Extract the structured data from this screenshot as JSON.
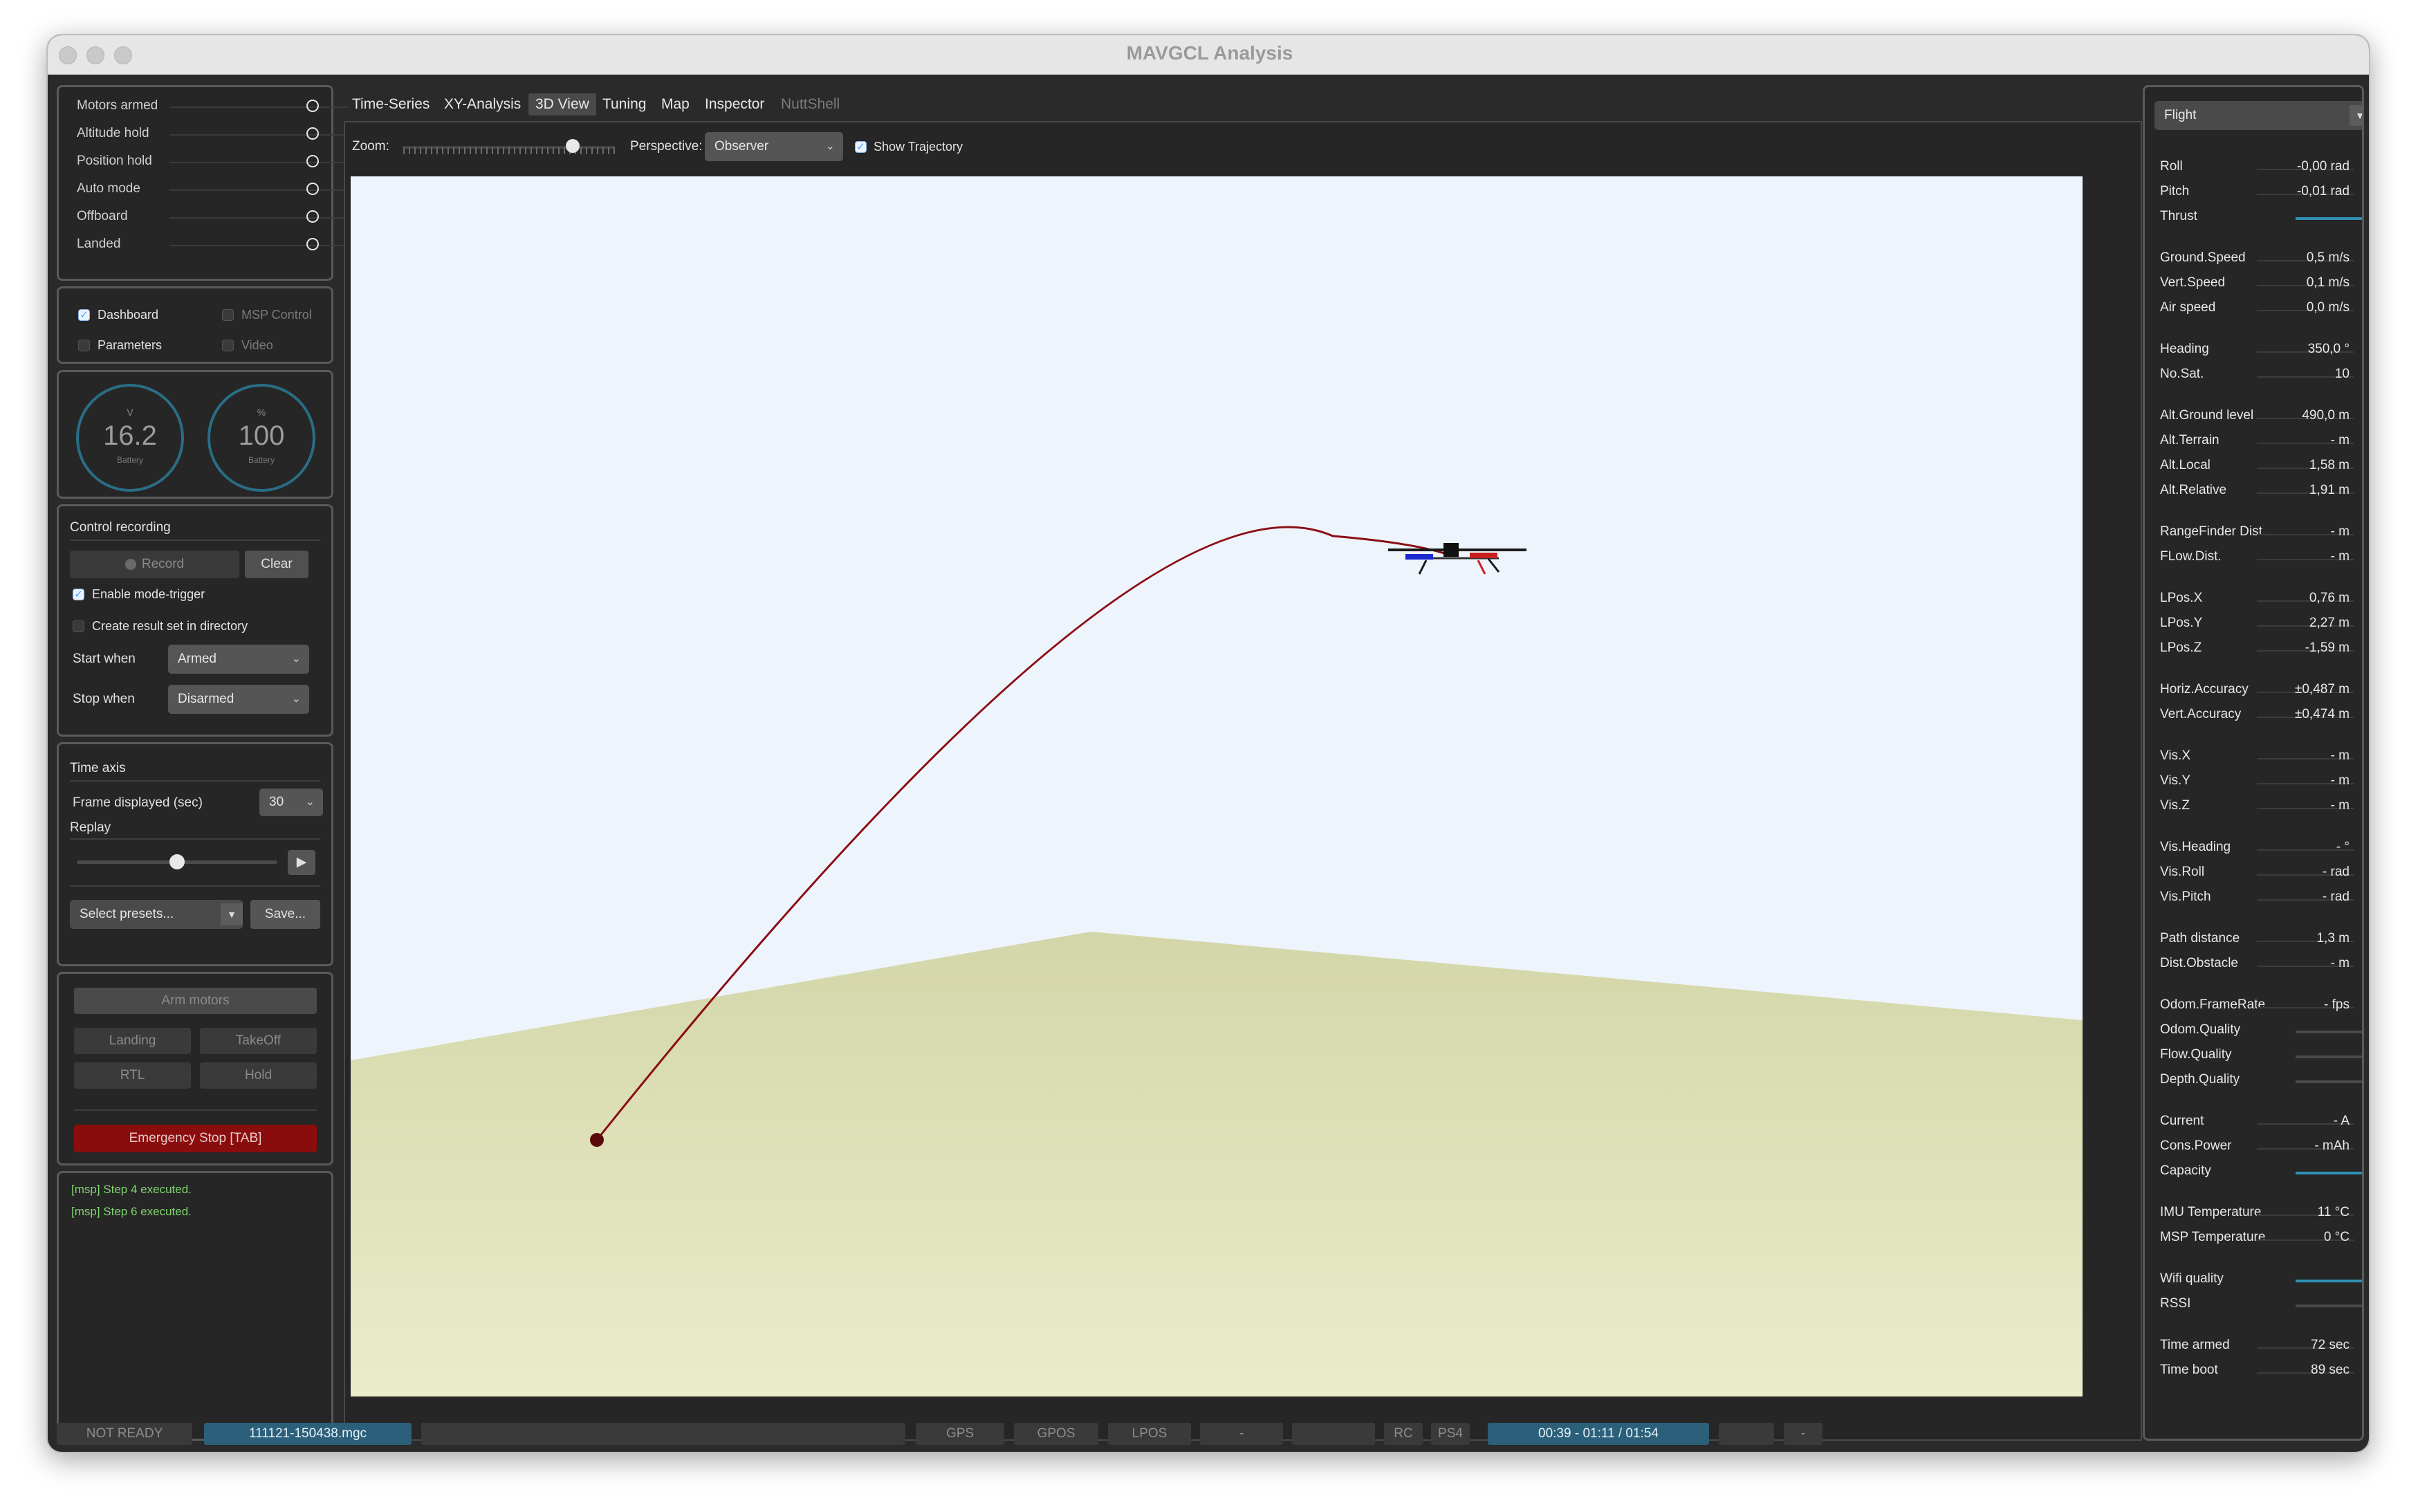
{
  "window": {
    "title": "MAVGCL Analysis"
  },
  "status_flags": [
    {
      "label": "Motors armed"
    },
    {
      "label": "Altitude hold"
    },
    {
      "label": "Position hold"
    },
    {
      "label": "Auto mode"
    },
    {
      "label": "Offboard"
    },
    {
      "label": "Landed"
    }
  ],
  "views": {
    "dashboard": "Dashboard",
    "msp_control": "MSP Control",
    "parameters": "Parameters",
    "video": "Video"
  },
  "gauges": [
    {
      "unit": "V",
      "value": "16.2",
      "label": "Battery"
    },
    {
      "unit": "%",
      "value": "100",
      "label": "Battery"
    }
  ],
  "recording": {
    "title": "Control recording",
    "record": "Record",
    "clear": "Clear",
    "enable_mode_trigger": "Enable mode-trigger",
    "create_result_set": "Create result set in directory",
    "start_when_label": "Start when",
    "start_when_value": "Armed",
    "stop_when_label": "Stop when",
    "stop_when_value": "Disarmed"
  },
  "time_axis": {
    "title": "Time axis",
    "frame_label": "Frame displayed (sec)",
    "frame_value": "30",
    "replay_label": "Replay",
    "replay_position": 0.5,
    "presets_placeholder": "Select presets...",
    "save": "Save..."
  },
  "commands": {
    "arm": "Arm motors",
    "landing": "Landing",
    "takeoff": "TakeOff",
    "rtl": "RTL",
    "hold": "Hold",
    "emergency": "Emergency Stop [TAB]"
  },
  "console": [
    "[msp] Step 4 executed.",
    "[msp] Step 6 executed."
  ],
  "tabs": [
    {
      "label": "Time-Series"
    },
    {
      "label": "XY-Analysis"
    },
    {
      "label": "3D View"
    },
    {
      "label": "Tuning"
    },
    {
      "label": "Map"
    },
    {
      "label": "Inspector"
    },
    {
      "label": "NuttShell"
    }
  ],
  "view3d": {
    "zoom_label": "Zoom:",
    "zoom_position": 0.82,
    "perspective_label": "Perspective:",
    "perspective_value": "Observer",
    "show_trajectory": "Show Trajectory"
  },
  "right_panel": {
    "mode": "Flight",
    "rows": [
      {
        "k": "Roll",
        "v": "-0,00 rad"
      },
      {
        "k": "Pitch",
        "v": "-0,01 rad"
      },
      {
        "k": "Thrust",
        "bar": 0.7
      },
      {
        "k": "Ground.Speed",
        "v": "0,5 m/s"
      },
      {
        "k": "Vert.Speed",
        "v": "0,1 m/s"
      },
      {
        "k": "Air speed",
        "v": "0,0 m/s"
      },
      {
        "k": "Heading",
        "v": "350,0 °"
      },
      {
        "k": "No.Sat.",
        "v": "10"
      },
      {
        "k": "Alt.Ground level",
        "v": "490,0 m"
      },
      {
        "k": "Alt.Terrain",
        "v": "- m"
      },
      {
        "k": "Alt.Local",
        "v": "1,58 m"
      },
      {
        "k": "Alt.Relative",
        "v": "1,91 m"
      },
      {
        "k": "RangeFinder Dist.",
        "v": "- m"
      },
      {
        "k": "FLow.Dist.",
        "v": "- m"
      },
      {
        "k": "LPos.X",
        "v": "0,76 m"
      },
      {
        "k": "LPos.Y",
        "v": "2,27 m"
      },
      {
        "k": "LPos.Z",
        "v": "-1,59 m"
      },
      {
        "k": "Horiz.Accuracy",
        "v": "±0,487 m"
      },
      {
        "k": "Vert.Accuracy",
        "v": "±0,474 m"
      },
      {
        "k": "Vis.X",
        "v": "- m"
      },
      {
        "k": "Vis.Y",
        "v": "- m"
      },
      {
        "k": "Vis.Z",
        "v": "- m"
      },
      {
        "k": "Vis.Heading",
        "v": "- °"
      },
      {
        "k": "Vis.Roll",
        "v": "- rad"
      },
      {
        "k": "Vis.Pitch",
        "v": "- rad"
      },
      {
        "k": "Path distance",
        "v": "1,3 m"
      },
      {
        "k": "Dist.Obstacle",
        "v": "- m"
      },
      {
        "k": "Odom.FrameRate",
        "v": "- fps"
      },
      {
        "k": "Odom.Quality",
        "bar": 0
      },
      {
        "k": "Flow.Quality",
        "bar": 0
      },
      {
        "k": "Depth.Quality",
        "bar": 0
      },
      {
        "k": "Current",
        "v": "- A"
      },
      {
        "k": "Cons.Power",
        "v": "- mAh"
      },
      {
        "k": "Capacity",
        "bar": 1.0
      },
      {
        "k": "IMU Temperature",
        "v": "11 °C"
      },
      {
        "k": "MSP Temperature",
        "v": "0 °C"
      },
      {
        "k": "Wifi quality",
        "bar": 1.0
      },
      {
        "k": "RSSI",
        "bar": 0
      },
      {
        "k": "Time armed",
        "v": "72 sec"
      },
      {
        "k": "Time boot",
        "v": "89 sec"
      }
    ]
  },
  "statusbar": {
    "ready": "NOT READY",
    "file": "111121-150438.mgc",
    "gps": "GPS",
    "gpos": "GPOS",
    "lpos": "LPOS",
    "dash1": "-",
    "rc": "RC",
    "ps4": "PS4",
    "time": "00:39 - 01:11 / 01:54",
    "dash2": "-"
  },
  "colors": {
    "sky": "#eef4fb",
    "ground": "#d9dbb0",
    "trajectory": "#8b0d14",
    "emergency": "#8a0d0d",
    "accent": "#2f8fb5",
    "time_bg": "#2c5f7a"
  }
}
